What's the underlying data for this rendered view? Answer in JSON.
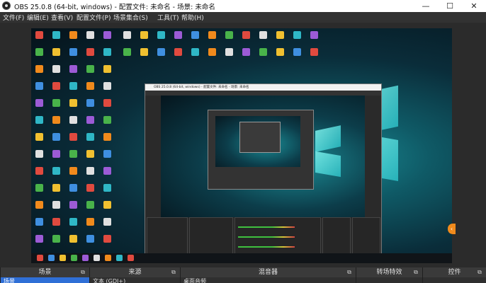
{
  "window": {
    "title": "OBS 25.0.8 (64-bit, windows) - 配置文件: 未命名 - 场景: 未命名",
    "minimize_glyph": "—",
    "maximize_glyph": "☐",
    "close_glyph": "✕"
  },
  "menubar": {
    "items": [
      "文件(F)",
      "编辑(E)",
      "查看(V)",
      "配置文件(P)",
      "场景集合(S)",
      "工具(T)",
      "帮助(H)"
    ]
  },
  "nested_obs": {
    "title": "OBS 25.0.8 (64-bit, windows) - 配置文件: 未命名 - 场景: 未命名"
  },
  "docks": {
    "scenes": {
      "title": "场景",
      "button_glyph": "⧉",
      "row_text": "场景"
    },
    "sources": {
      "title": "来源",
      "button_glyph": "⧉",
      "row_text": "文本 (GDI+)"
    },
    "mixer": {
      "title": "混音器",
      "button_glyph": "⧉",
      "row_text": "桌面音频"
    },
    "transitions": {
      "title": "转场特效",
      "button_glyph": "⧉"
    },
    "controls": {
      "title": "控件",
      "button_glyph": "⧉"
    }
  },
  "colors": {
    "accent_orange": "#f08a1c",
    "wallpaper_glow": "#1a8f98",
    "meter_green": "#3fbf3f",
    "meter_yellow": "#d7c53a",
    "meter_red": "#d04040"
  }
}
